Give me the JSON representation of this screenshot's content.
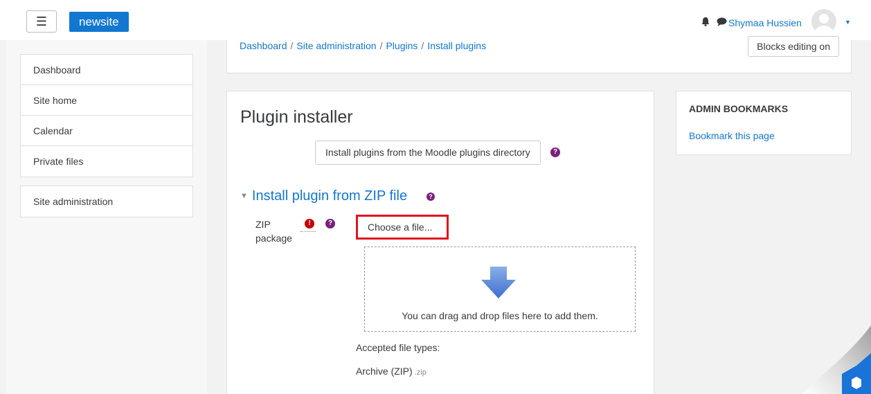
{
  "navbar": {
    "menu_icon": "hamburger-icon",
    "brand": "newsite",
    "user_name": "Shymaa Hussien"
  },
  "breadcrumb": {
    "items": [
      "Dashboard",
      "Site administration",
      "Plugins",
      "Install plugins"
    ],
    "separator": "/"
  },
  "header": {
    "edit_button": "Blocks editing on"
  },
  "drawer": {
    "items": [
      "Dashboard",
      "Site home",
      "Calendar",
      "Private files"
    ],
    "admin_item": "Site administration"
  },
  "main": {
    "title": "Plugin installer",
    "directory_button": "Install plugins from the Moodle plugins directory",
    "section_title": "Install plugin from ZIP file",
    "zip_label": "ZIP package",
    "choose_button": "Choose a file...",
    "drop_text": "You can drag and drop files here to add them.",
    "accepted_label": "Accepted file types:",
    "archive_type": "Archive (ZIP)",
    "archive_ext": ".zip"
  },
  "bookmarks": {
    "title": "ADMIN BOOKMARKS",
    "link": "Bookmark this page"
  },
  "colors": {
    "accent": "#1177d1",
    "help": "#7a1f7d",
    "required": "#c80000",
    "highlight": "#e0141e"
  }
}
